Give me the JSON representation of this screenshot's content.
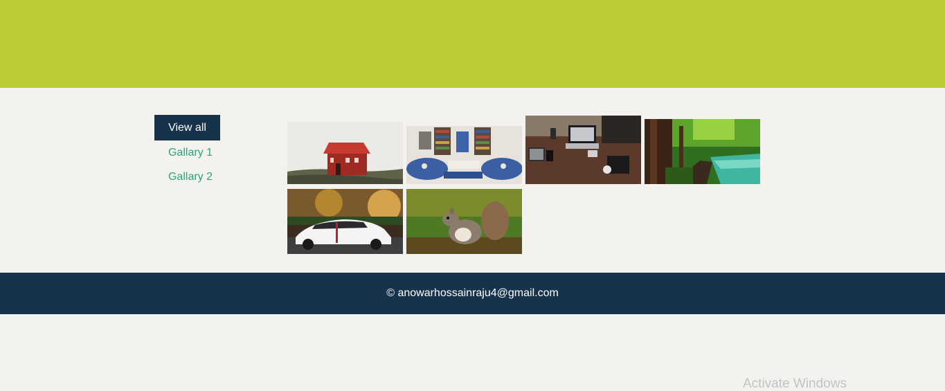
{
  "filters": {
    "view_all": "View all",
    "gallery_1": "Gallary 1",
    "gallery_2": "Gallary 2"
  },
  "gallery": [
    {
      "subject": "red-house"
    },
    {
      "subject": "blue-living-room"
    },
    {
      "subject": "desk-workspace"
    },
    {
      "subject": "forest-river"
    },
    {
      "subject": "white-sports-car"
    },
    {
      "subject": "squirrel"
    }
  ],
  "footer": {
    "text": "© anowarhossainraju4@gmail.com"
  },
  "watermark": {
    "text": "Activate Windows"
  },
  "colors": {
    "banner": "#bdcc35",
    "dark_navy": "#17324b",
    "link_green": "#2ca37d",
    "page_bg": "#f3f2ef"
  }
}
